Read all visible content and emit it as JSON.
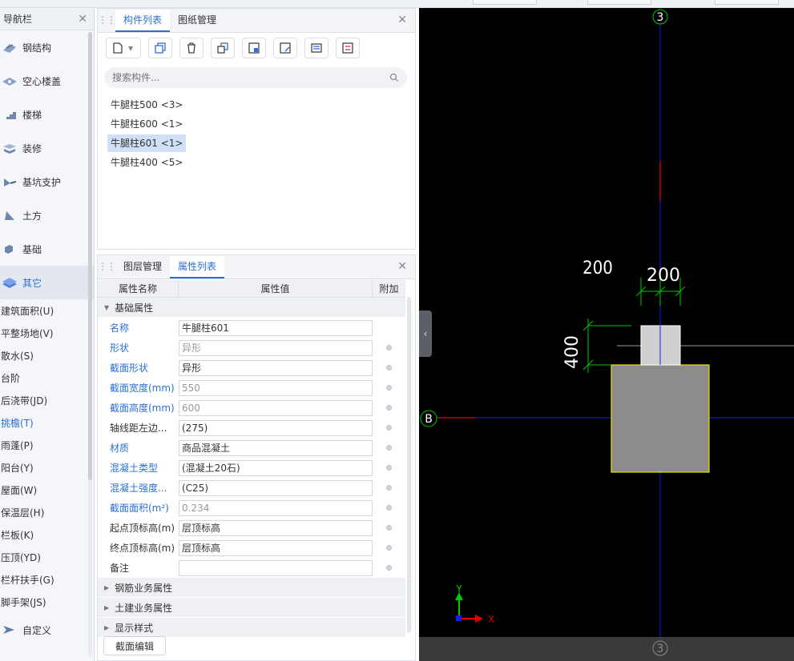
{
  "nav": {
    "title": "导航栏",
    "categories": [
      {
        "label": "钢结构",
        "icon": "steel-structure-icon"
      },
      {
        "label": "空心楼盖",
        "icon": "hollow-floor-icon"
      },
      {
        "label": "楼梯",
        "icon": "stairs-icon"
      },
      {
        "label": "装修",
        "icon": "decoration-icon"
      },
      {
        "label": "基坑支护",
        "icon": "pit-support-icon"
      },
      {
        "label": "土方",
        "icon": "earthwork-icon"
      },
      {
        "label": "基础",
        "icon": "foundation-icon"
      },
      {
        "label": "其它",
        "icon": "other-icon"
      }
    ],
    "subitems": [
      "建筑面积(U)",
      "平整场地(V)",
      "散水(S)",
      "台阶",
      "后浇带(JD)",
      "挑檐(T)",
      "雨蓬(P)",
      "阳台(Y)",
      "屋面(W)",
      "保温层(H)",
      "栏板(K)",
      "压顶(YD)",
      "栏杆扶手(G)",
      "脚手架(JS)"
    ],
    "custom": {
      "label": "自定义",
      "icon": "custom-icon"
    }
  },
  "component_panel": {
    "tabs": [
      "构件列表",
      "图纸管理"
    ],
    "search_placeholder": "搜索构件...",
    "components": [
      "牛腿柱500 <3>",
      "牛腿柱600 <1>",
      "牛腿柱601 <1>",
      "牛腿柱400 <5>"
    ],
    "selected_index": 2
  },
  "property_panel": {
    "tabs": [
      "图层管理",
      "属性列表"
    ],
    "headers": {
      "name": "属性名称",
      "value": "属性值",
      "extra": "附加"
    },
    "groups": {
      "basic": "基础属性",
      "rebar": "钢筋业务属性",
      "civil": "土建业务属性",
      "display": "显示样式"
    },
    "rows": [
      {
        "name": "名称",
        "value": "牛腿柱601"
      },
      {
        "name": "形状",
        "value": "异形"
      },
      {
        "name": "截面形状",
        "value": "异形"
      },
      {
        "name": "截面宽度(mm)",
        "value": "550"
      },
      {
        "name": "截面高度(mm)",
        "value": "600"
      },
      {
        "name": "轴线距左边...",
        "value": "(275)"
      },
      {
        "name": "材质",
        "value": "商品混凝土"
      },
      {
        "name": "混凝土类型",
        "value": "(混凝土20石)"
      },
      {
        "name": "混凝土强度...",
        "value": "(C25)"
      },
      {
        "name": "截面面积(m²)",
        "value": "0.234"
      },
      {
        "name": "起点顶标高(m)",
        "value": "层顶标高"
      },
      {
        "name": "终点顶标高(m)",
        "value": "层顶标高"
      },
      {
        "name": "备注",
        "value": ""
      }
    ],
    "section_edit_button": "截面编辑"
  },
  "canvas": {
    "axis_top": "3",
    "axis_bottom": "3",
    "axis_left": "B",
    "dim_left": "200",
    "dim_top": "200",
    "dim_side": "400",
    "ucs_x": "X",
    "ucs_y": "Y",
    "collapse_glyph": "‹",
    "colors": {
      "axis": "#1a1aff",
      "dim": "#00c800",
      "column": "#8c8c8c",
      "column_outline": "#e8e000",
      "small_fill": "#cfcfcf",
      "ref_line": "#c80000"
    }
  }
}
